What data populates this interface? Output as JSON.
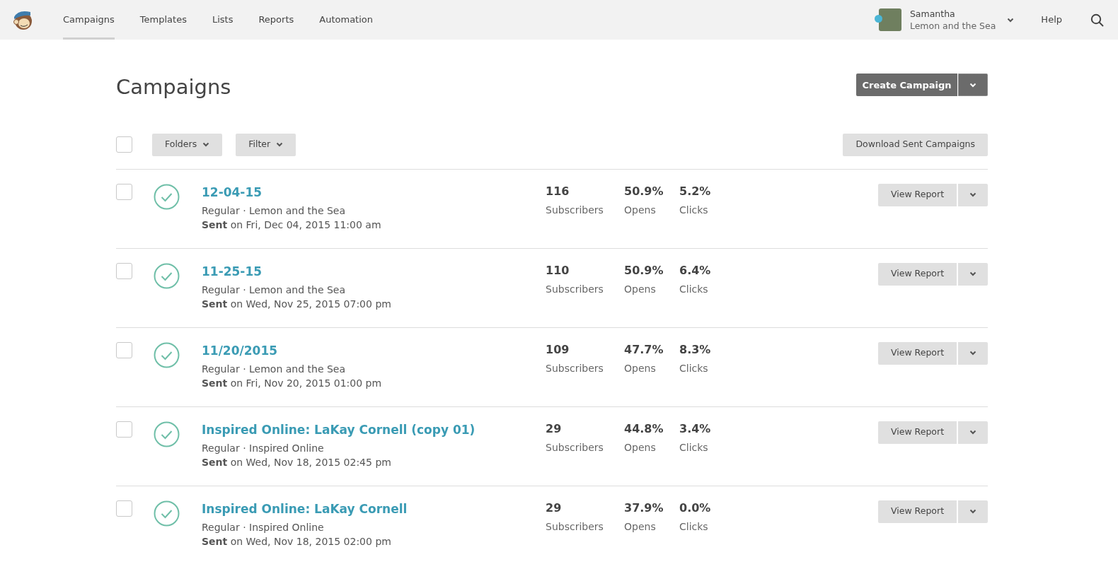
{
  "nav": {
    "tabs": [
      {
        "label": "Campaigns",
        "selected": true
      },
      {
        "label": "Templates",
        "selected": false
      },
      {
        "label": "Lists",
        "selected": false
      },
      {
        "label": "Reports",
        "selected": false
      },
      {
        "label": "Automation",
        "selected": false
      }
    ],
    "account": {
      "name": "Samantha",
      "org": "Lemon and the Sea"
    },
    "help": "Help"
  },
  "page": {
    "title": "Campaigns",
    "create_button": "Create Campaign"
  },
  "toolbar": {
    "select_all": {
      "checked": false
    },
    "folders": "Folders",
    "filter": "Filter",
    "download": "Download Sent Campaigns"
  },
  "campaigns": [
    {
      "checked": false,
      "title": "12-04-15",
      "meta": "Regular · Lemon and the Sea",
      "sent": "**Sent** on Fri, Dec 04, 2015 11:00 am",
      "subscribers": "116",
      "subscribers_label": "Subscribers",
      "opens": "50.9%",
      "opens_label": "Opens",
      "clicks": "5.2%",
      "clicks_label": "Clicks",
      "action": "View Report"
    },
    {
      "checked": false,
      "title": "11-25-15",
      "meta": "Regular · Lemon and the Sea",
      "sent": "**Sent** on Wed, Nov 25, 2015 07:00 pm",
      "subscribers": "110",
      "subscribers_label": "Subscribers",
      "opens": "50.9%",
      "opens_label": "Opens",
      "clicks": "6.4%",
      "clicks_label": "Clicks",
      "action": "View Report"
    },
    {
      "checked": false,
      "title": "11/20/2015",
      "meta": "Regular · Lemon and the Sea",
      "sent": "**Sent** on Fri, Nov 20, 2015 01:00 pm",
      "subscribers": "109",
      "subscribers_label": "Subscribers",
      "opens": "47.7%",
      "opens_label": "Opens",
      "clicks": "8.3%",
      "clicks_label": "Clicks",
      "action": "View Report"
    },
    {
      "checked": false,
      "title": "Inspired Online: LaKay Cornell (copy 01)",
      "meta": "Regular · Inspired Online",
      "sent": "**Sent** on Wed, Nov 18, 2015 02:45 pm",
      "subscribers": "29",
      "subscribers_label": "Subscribers",
      "opens": "44.8%",
      "opens_label": "Opens",
      "clicks": "3.4%",
      "clicks_label": "Clicks",
      "action": "View Report"
    },
    {
      "checked": false,
      "title": "Inspired Online: LaKay Cornell",
      "meta": "Regular · Inspired Online",
      "sent": "**Sent** on Wed, Nov 18, 2015 02:00 pm",
      "subscribers": "29",
      "subscribers_label": "Subscribers",
      "opens": "37.9%",
      "opens_label": "Opens",
      "clicks": "0.0%",
      "clicks_label": "Clicks",
      "action": "View Report"
    }
  ]
}
